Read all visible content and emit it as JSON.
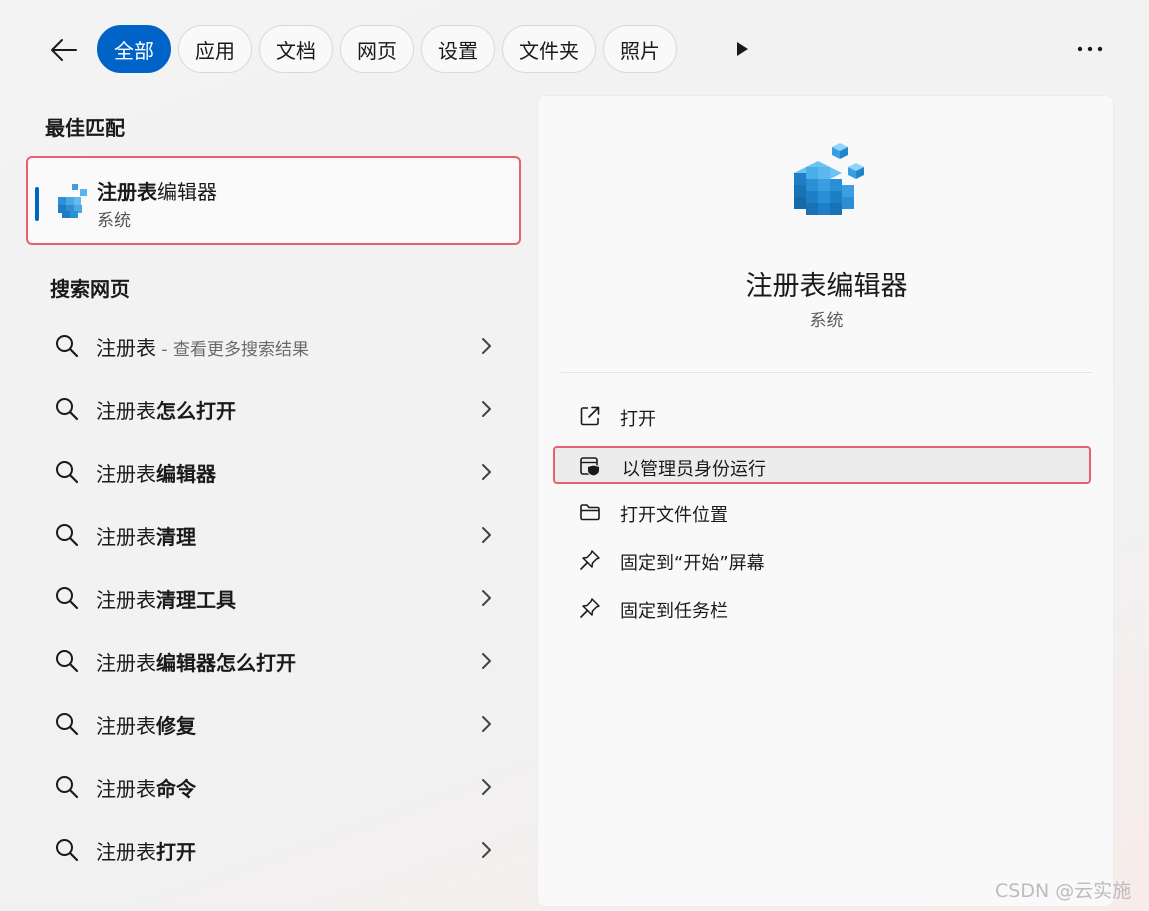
{
  "tabs": [
    "全部",
    "应用",
    "文档",
    "网页",
    "设置",
    "文件夹",
    "照片"
  ],
  "left": {
    "best_match_title": "最佳匹配",
    "best_match": {
      "name_bold": "注册表",
      "name_rest": "编辑器",
      "type": "系统"
    },
    "web_search_title": "搜索网页",
    "search_items": [
      {
        "prefix": "注册表",
        "bold": "",
        "hint": " - 查看更多搜索结果"
      },
      {
        "prefix": "注册表",
        "bold": "怎么打开",
        "hint": ""
      },
      {
        "prefix": "注册表",
        "bold": "编辑器",
        "hint": ""
      },
      {
        "prefix": "注册表",
        "bold": "清理",
        "hint": ""
      },
      {
        "prefix": "注册表",
        "bold": "清理工具",
        "hint": ""
      },
      {
        "prefix": "注册表",
        "bold": "编辑器怎么打开",
        "hint": ""
      },
      {
        "prefix": "注册表",
        "bold": "修复",
        "hint": ""
      },
      {
        "prefix": "注册表",
        "bold": "命令",
        "hint": ""
      },
      {
        "prefix": "注册表",
        "bold": "打开",
        "hint": ""
      }
    ]
  },
  "detail": {
    "app_name": "注册表编辑器",
    "app_type": "系统",
    "actions": [
      {
        "label": "打开",
        "icon": "open-external-icon"
      },
      {
        "label": "以管理员身份运行",
        "icon": "admin-shield-icon"
      },
      {
        "label": "打开文件位置",
        "icon": "folder-icon"
      },
      {
        "label": "固定到“开始”屏幕",
        "icon": "pin-icon"
      },
      {
        "label": "固定到任务栏",
        "icon": "pin-icon"
      }
    ]
  },
  "watermark": "CSDN @云实施",
  "colors": {
    "accent": "#0063c8",
    "highlight_border": "#e8606e"
  }
}
